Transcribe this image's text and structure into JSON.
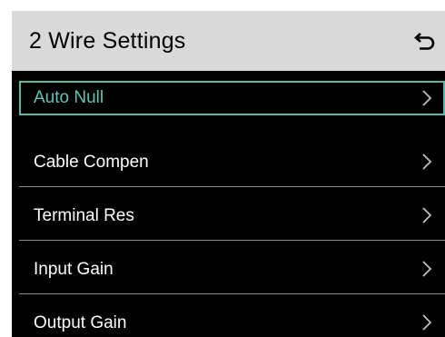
{
  "header": {
    "title": "2 Wire Settings",
    "back_icon": "back-arrow-icon"
  },
  "menu": {
    "items": [
      {
        "label": "Auto Null",
        "selected": true
      },
      {
        "label": "Cable Compen",
        "selected": false
      },
      {
        "label": "Terminal Res",
        "selected": false
      },
      {
        "label": "Input Gain",
        "selected": false
      },
      {
        "label": "Output Gain",
        "selected": false
      }
    ],
    "chevron_icon": "chevron-right-icon"
  },
  "colors": {
    "header_bg": "#d9d9d9",
    "screen_bg": "#000000",
    "selected_accent": "#55b8ac",
    "text": "#ffffff",
    "separator": "#8a8a8a"
  }
}
